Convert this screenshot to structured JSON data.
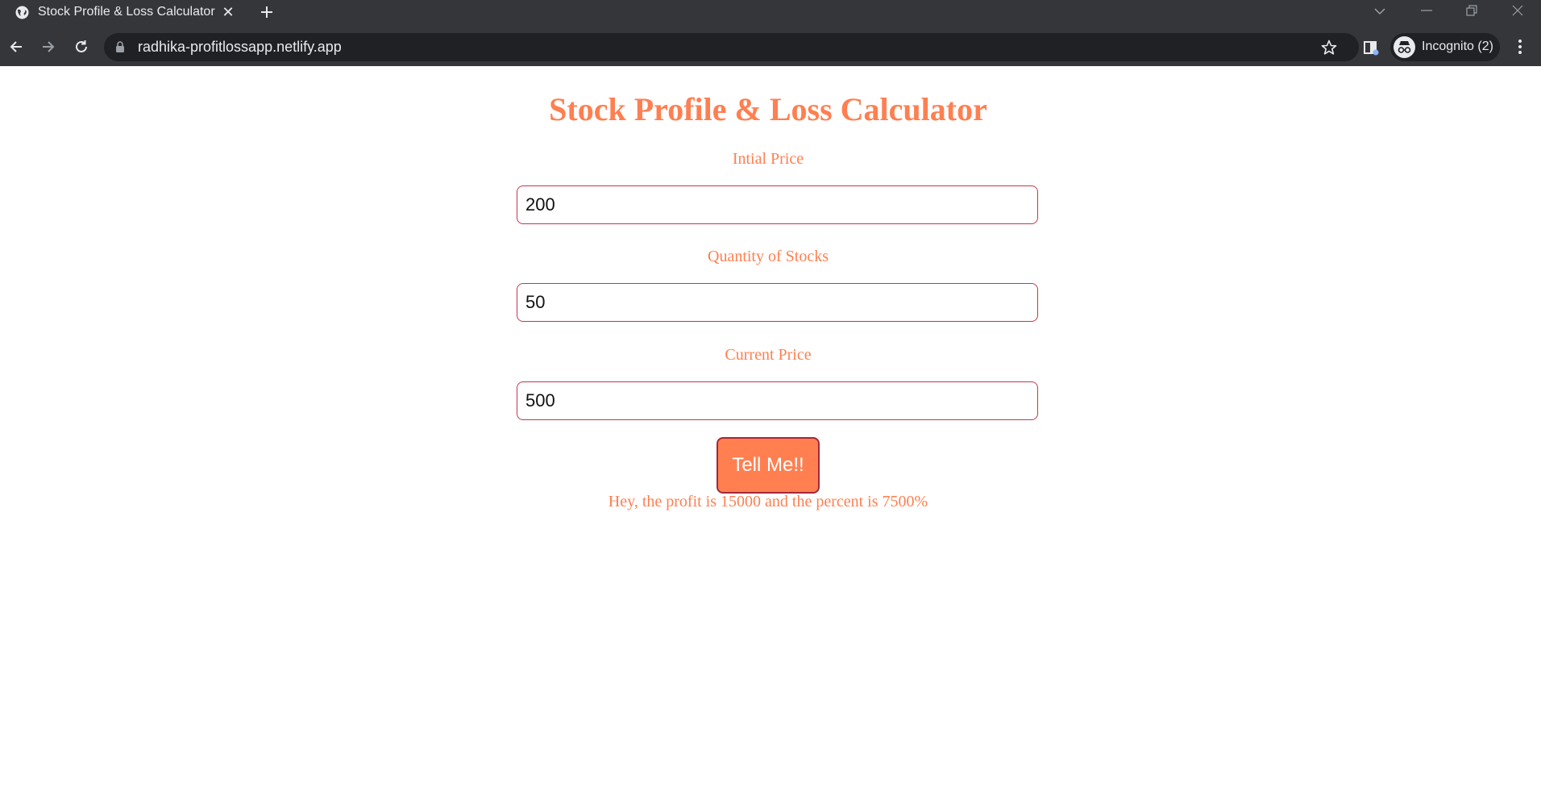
{
  "browser": {
    "tab_title": "Stock Profile & Loss Calculator",
    "url": "radhika-profitlossapp.netlify.app",
    "incognito_label": "Incognito (2)",
    "colors": {
      "chrome": "#35363a",
      "omnibox": "#202124",
      "text": "#e8eaed"
    }
  },
  "page": {
    "title": "Stock Profile & Loss Calculator",
    "fields": [
      {
        "label": "Intial Price",
        "value": "200"
      },
      {
        "label": "Quantity of Stocks",
        "value": "50"
      },
      {
        "label": "Current Price",
        "value": "500"
      }
    ],
    "button_label": "Tell Me!!",
    "result": "Hey, the profit is 15000 and the percent is 7500%",
    "colors": {
      "accent": "#ff7f50",
      "input_border": "#c0394a"
    }
  }
}
